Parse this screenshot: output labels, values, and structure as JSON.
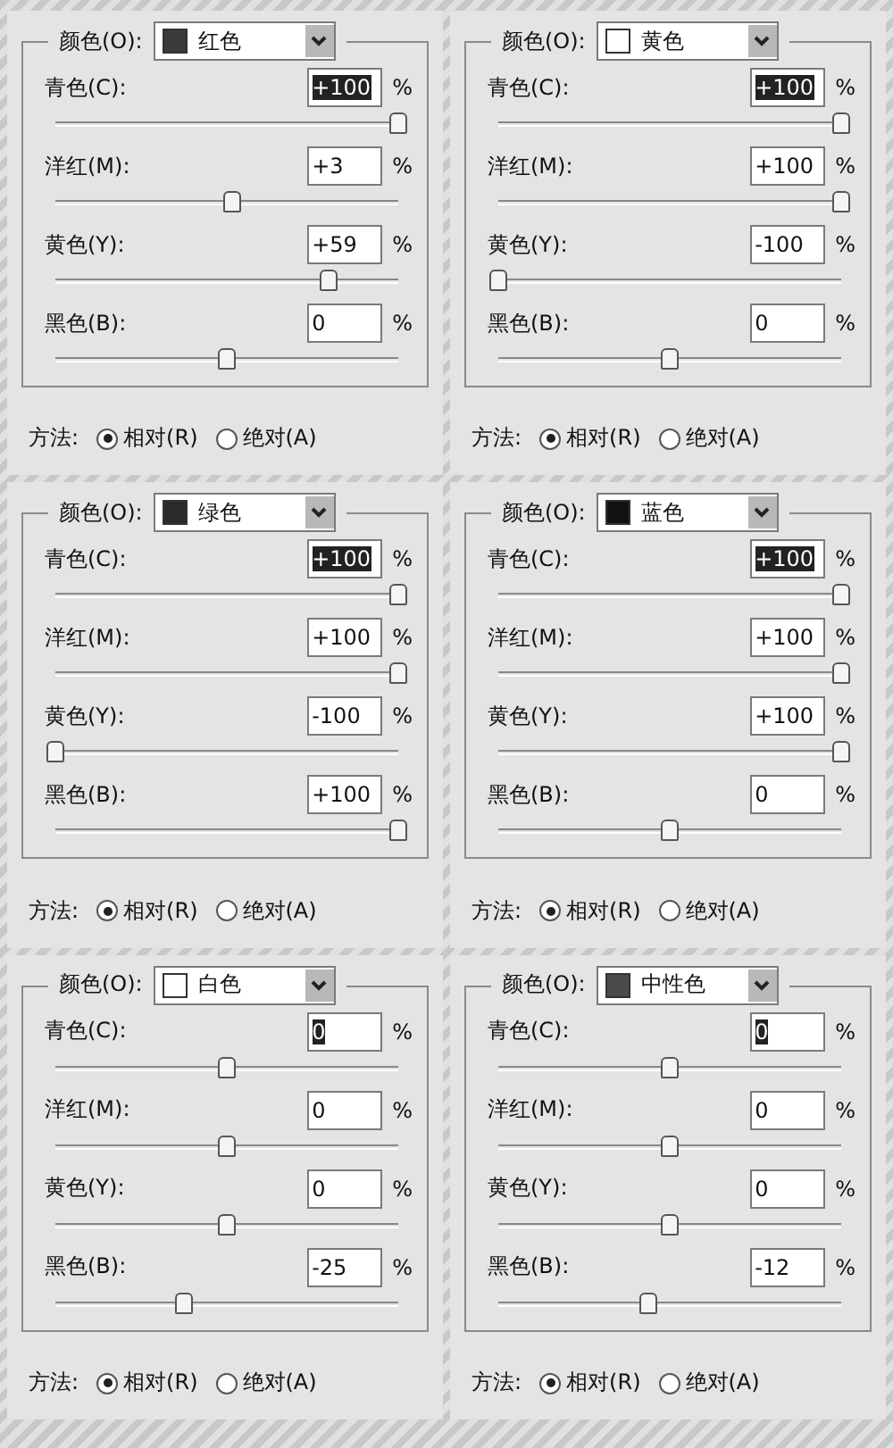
{
  "panels": [
    {
      "color_label": "颜色(O):",
      "color_name": "红色",
      "color": "#3a3a3a",
      "sliders": [
        {
          "label": "青色(C):",
          "value": "+100",
          "unit": "%",
          "highlighted": true,
          "level": 1
        },
        {
          "label": "洋红(M):",
          "value": "+3",
          "unit": "%",
          "highlighted": false,
          "level": 0.515
        },
        {
          "label": "黄色(Y):",
          "value": "+59",
          "unit": "%",
          "highlighted": false,
          "level": 0.795
        },
        {
          "label": "黑色(B):",
          "value": "0",
          "unit": "%",
          "highlighted": false,
          "level": 0.5
        }
      ],
      "method": {
        "label": "方法:",
        "options": [
          {
            "label": "相对(R)",
            "selected": true
          },
          {
            "label": "绝对(A)",
            "selected": false
          }
        ]
      }
    },
    {
      "color_label": "颜色(O):",
      "color_name": "黄色",
      "color": "#ffffff",
      "sliders": [
        {
          "label": "青色(C):",
          "value": "+100",
          "unit": "%",
          "highlighted": true,
          "level": 1
        },
        {
          "label": "洋红(M):",
          "value": "+100",
          "unit": "%",
          "highlighted": false,
          "level": 1
        },
        {
          "label": "黄色(Y):",
          "value": "-100",
          "unit": "%",
          "highlighted": false,
          "level": 0
        },
        {
          "label": "黑色(B):",
          "value": "0",
          "unit": "%",
          "highlighted": false,
          "level": 0.5
        }
      ],
      "method": {
        "label": "方法:",
        "options": [
          {
            "label": "相对(R)",
            "selected": true
          },
          {
            "label": "绝对(A)",
            "selected": false
          }
        ]
      }
    },
    {
      "color_label": "颜色(O):",
      "color_name": "绿色",
      "color": "#2a2a2a",
      "sliders": [
        {
          "label": "青色(C):",
          "value": "+100",
          "unit": "%",
          "highlighted": true,
          "level": 1
        },
        {
          "label": "洋红(M):",
          "value": "+100",
          "unit": "%",
          "highlighted": false,
          "level": 1
        },
        {
          "label": "黄色(Y):",
          "value": "-100",
          "unit": "%",
          "highlighted": false,
          "level": 0
        },
        {
          "label": "黑色(B):",
          "value": "+100",
          "unit": "%",
          "highlighted": false,
          "level": 1
        }
      ],
      "method": {
        "label": "方法:",
        "options": [
          {
            "label": "相对(R)",
            "selected": true
          },
          {
            "label": "绝对(A)",
            "selected": false
          }
        ]
      }
    },
    {
      "color_label": "颜色(O):",
      "color_name": "蓝色",
      "color": "#111111",
      "sliders": [
        {
          "label": "青色(C):",
          "value": "+100",
          "unit": "%",
          "highlighted": true,
          "level": 1
        },
        {
          "label": "洋红(M):",
          "value": "+100",
          "unit": "%",
          "highlighted": false,
          "level": 1
        },
        {
          "label": "黄色(Y):",
          "value": "+100",
          "unit": "%",
          "highlighted": false,
          "level": 1
        },
        {
          "label": "黑色(B):",
          "value": "0",
          "unit": "%",
          "highlighted": false,
          "level": 0.5
        }
      ],
      "method": {
        "label": "方法:",
        "options": [
          {
            "label": "相对(R)",
            "selected": true
          },
          {
            "label": "绝对(A)",
            "selected": false
          }
        ]
      }
    },
    {
      "color_label": "颜色(O):",
      "color_name": "白色",
      "color": "#ffffff",
      "sliders": [
        {
          "label": "青色(C):",
          "value": "0",
          "unit": "%",
          "highlighted": true,
          "level": 0.5
        },
        {
          "label": "洋红(M):",
          "value": "0",
          "unit": "%",
          "highlighted": false,
          "level": 0.5
        },
        {
          "label": "黄色(Y):",
          "value": "0",
          "unit": "%",
          "highlighted": false,
          "level": 0.5
        },
        {
          "label": "黑色(B):",
          "value": "-25",
          "unit": "%",
          "highlighted": false,
          "level": 0.375
        }
      ],
      "method": {
        "label": "方法:",
        "options": [
          {
            "label": "相对(R)",
            "selected": true
          },
          {
            "label": "绝对(A)",
            "selected": false
          }
        ]
      }
    },
    {
      "color_label": "颜色(O):",
      "color_name": "中性色",
      "color": "#4a4a4a",
      "sliders": [
        {
          "label": "青色(C):",
          "value": "0",
          "unit": "%",
          "highlighted": true,
          "level": 0.5
        },
        {
          "label": "洋红(M):",
          "value": "0",
          "unit": "%",
          "highlighted": false,
          "level": 0.5
        },
        {
          "label": "黄色(Y):",
          "value": "0",
          "unit": "%",
          "highlighted": false,
          "level": 0.5
        },
        {
          "label": "黑色(B):",
          "value": "-12",
          "unit": "%",
          "highlighted": false,
          "level": 0.44
        }
      ],
      "method": {
        "label": "方法:",
        "options": [
          {
            "label": "相对(R)",
            "selected": true
          },
          {
            "label": "绝对(A)",
            "selected": false
          }
        ]
      }
    }
  ]
}
